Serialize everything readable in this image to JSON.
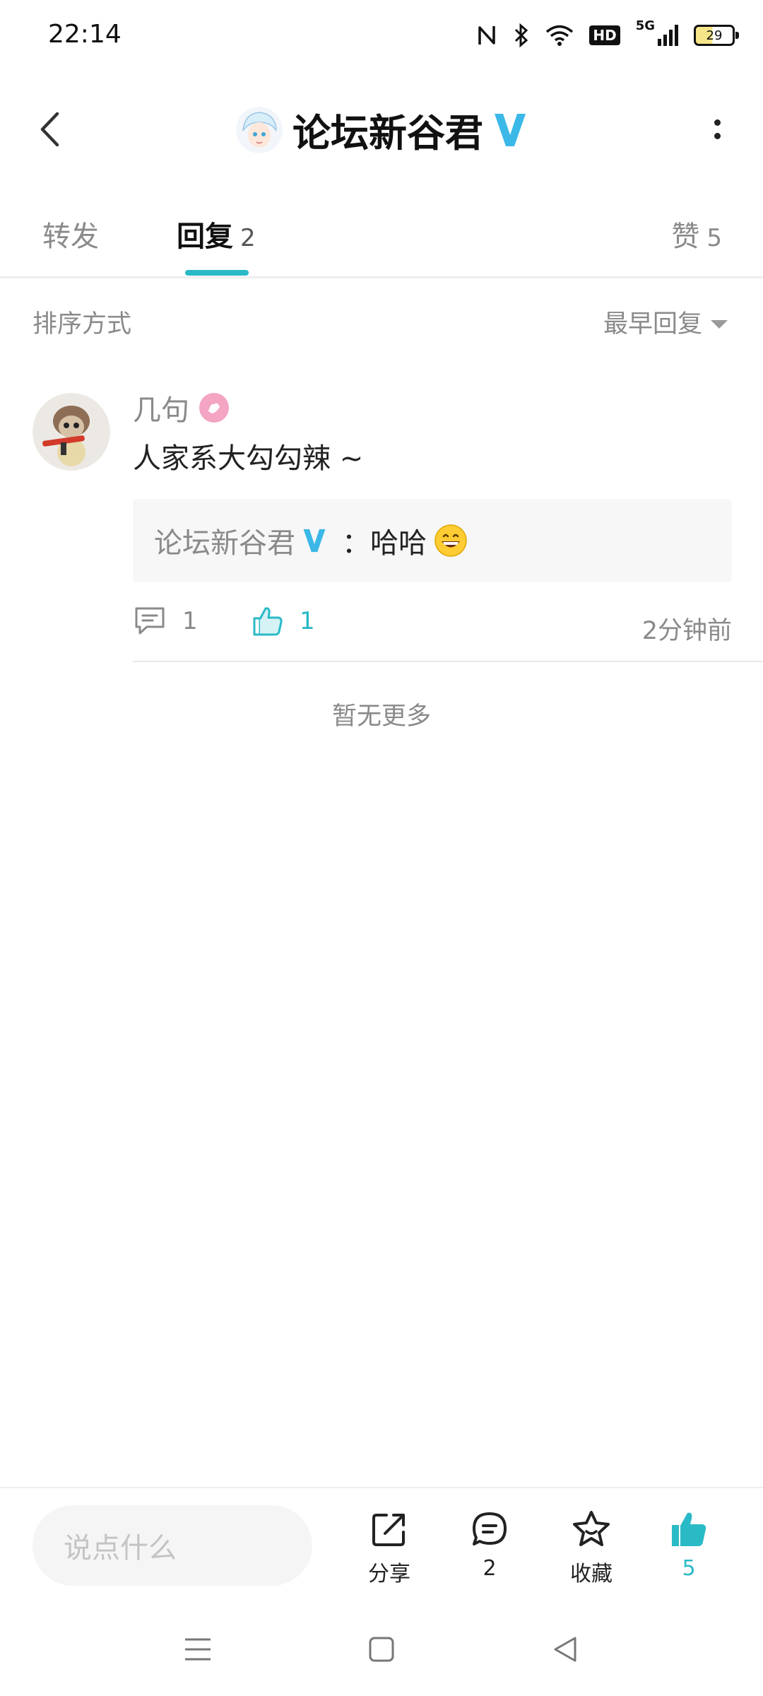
{
  "status_bar": {
    "time": "22:14",
    "network": "5G",
    "hd": "HD",
    "battery": "29",
    "icons": [
      "nfc-icon",
      "bluetooth-icon",
      "wifi-icon",
      "hd-icon",
      "signal-icon",
      "battery-icon"
    ]
  },
  "header": {
    "title": "论坛新谷君",
    "verified": "V"
  },
  "tabs": [
    {
      "label": "转发",
      "count": ""
    },
    {
      "label": "回复",
      "count": "2"
    },
    {
      "label": "赞",
      "count": "5"
    }
  ],
  "sort": {
    "label": "排序方式",
    "value": "最早回复"
  },
  "comment": {
    "author": "几句",
    "text": "人家系大勾勾辣 ~",
    "quote": {
      "author": "论坛新谷君",
      "text": "：哈哈"
    },
    "reply_count": "1",
    "like_count": "1",
    "time": "2分钟前"
  },
  "no_more": "暂无更多",
  "bottom_bar": {
    "input_placeholder": "说点什么",
    "share_label": "分享",
    "comment_count": "2",
    "favorite_label": "收藏",
    "like_count": "5"
  },
  "colors": {
    "accent": "#2abac6",
    "text_secondary": "#8a8a8a",
    "verified_blue": "#3bb8e8"
  }
}
